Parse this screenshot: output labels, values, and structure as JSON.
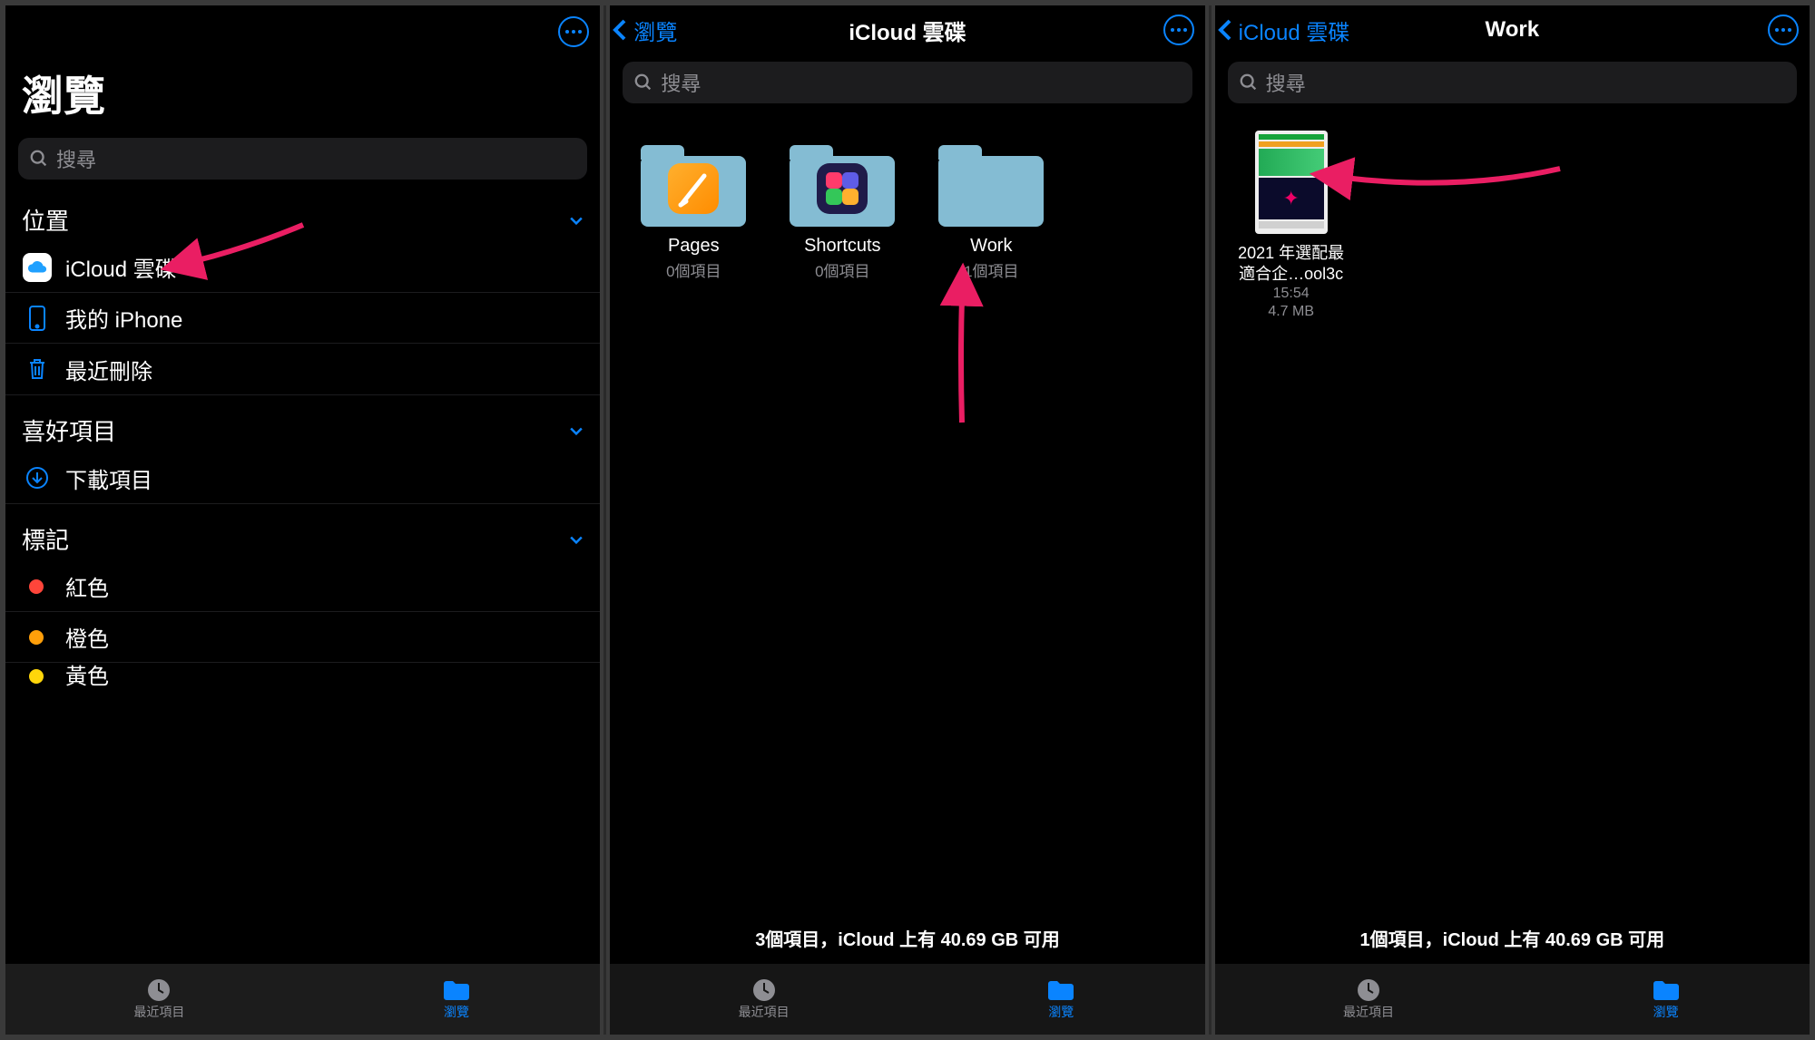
{
  "pane1": {
    "title": "瀏覽",
    "search_placeholder": "搜尋",
    "sections": {
      "locations": {
        "title": "位置",
        "items": {
          "icloud": "iCloud 雲碟",
          "myiphone": "我的 iPhone",
          "recentlydeleted": "最近刪除"
        }
      },
      "favorites": {
        "title": "喜好項目",
        "items": {
          "downloads": "下載項目"
        }
      },
      "tags": {
        "title": "標記",
        "items": {
          "red": "紅色",
          "orange": "橙色",
          "yellow": "黃色"
        }
      }
    },
    "tabbar": {
      "recents": "最近項目",
      "browse": "瀏覽"
    }
  },
  "pane2": {
    "back_label": "瀏覽",
    "title": "iCloud 雲碟",
    "search_placeholder": "搜尋",
    "folders": {
      "pages": {
        "name": "Pages",
        "sub": "0個項目"
      },
      "shortcuts": {
        "name": "Shortcuts",
        "sub": "0個項目"
      },
      "work": {
        "name": "Work",
        "sub": "1個項目"
      }
    },
    "status": "3個項目，iCloud 上有 40.69 GB 可用",
    "tabbar": {
      "recents": "最近項目",
      "browse": "瀏覽"
    }
  },
  "pane3": {
    "back_label": "iCloud 雲碟",
    "title": "Work",
    "search_placeholder": "搜尋",
    "file": {
      "name_l1": "2021 年選配最",
      "name_l2": "適合企…ool3c",
      "time": "15:54",
      "size": "4.7 MB"
    },
    "status": "1個項目，iCloud 上有 40.69 GB 可用",
    "tabbar": {
      "recents": "最近項目",
      "browse": "瀏覽"
    }
  },
  "colors": {
    "red": "#ff453a",
    "orange": "#ff9f0a",
    "yellow": "#ffd60a"
  }
}
